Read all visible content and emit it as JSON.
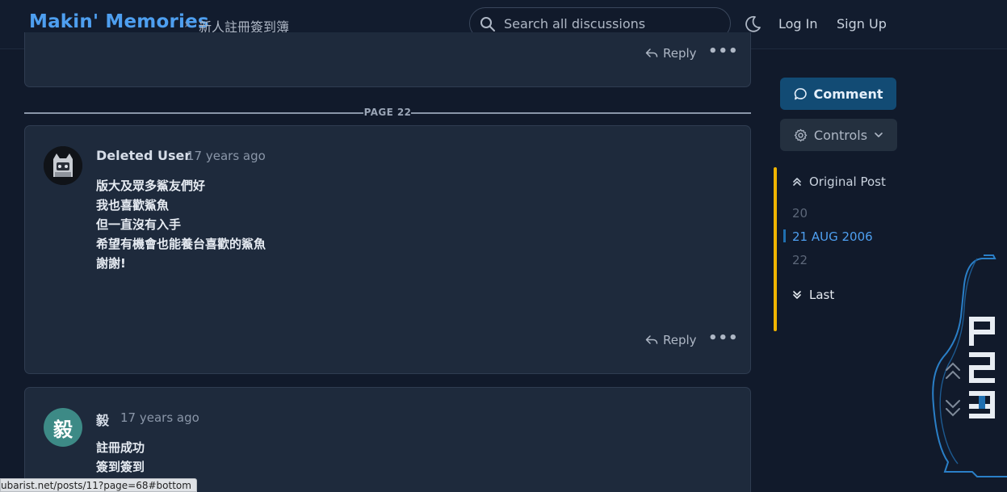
{
  "header": {
    "brand": "Makin' Memories",
    "crumb_sep": "›",
    "crumb": "新人註冊簽到簿",
    "search_placeholder": "Search all discussions",
    "login": "Log In",
    "signup": "Sign Up"
  },
  "prev_post": {
    "reply": "Reply",
    "more": "•••"
  },
  "page_divider": "PAGE 22",
  "posts": [
    {
      "username": "Deleted User",
      "time": "17 years ago",
      "lines": [
        "版大及眾多鯊友們好",
        "我也喜歡鯊魚",
        "但一直沒有入手",
        "希望有機會也能養台喜歡的鯊魚",
        "謝謝!"
      ],
      "reply": "Reply",
      "more": "•••"
    },
    {
      "avatar_letter": "毅",
      "avatar_color": "#3d8a86",
      "username": "毅",
      "time": "17 years ago",
      "lines": [
        "註冊成功",
        "簽到簽到"
      ]
    }
  ],
  "sidebar": {
    "comment": "Comment",
    "controls": "Controls",
    "original_post": "Original Post",
    "prev_page": "20",
    "current": "21 AUG 2006",
    "next_page": "22",
    "last": "Last"
  },
  "status_url": "ubarist.net/posts/11?page=68#bottom",
  "colors": {
    "brand": "#4e9ff0",
    "accent": "#124b74",
    "scrubber": "#f0b400"
  }
}
